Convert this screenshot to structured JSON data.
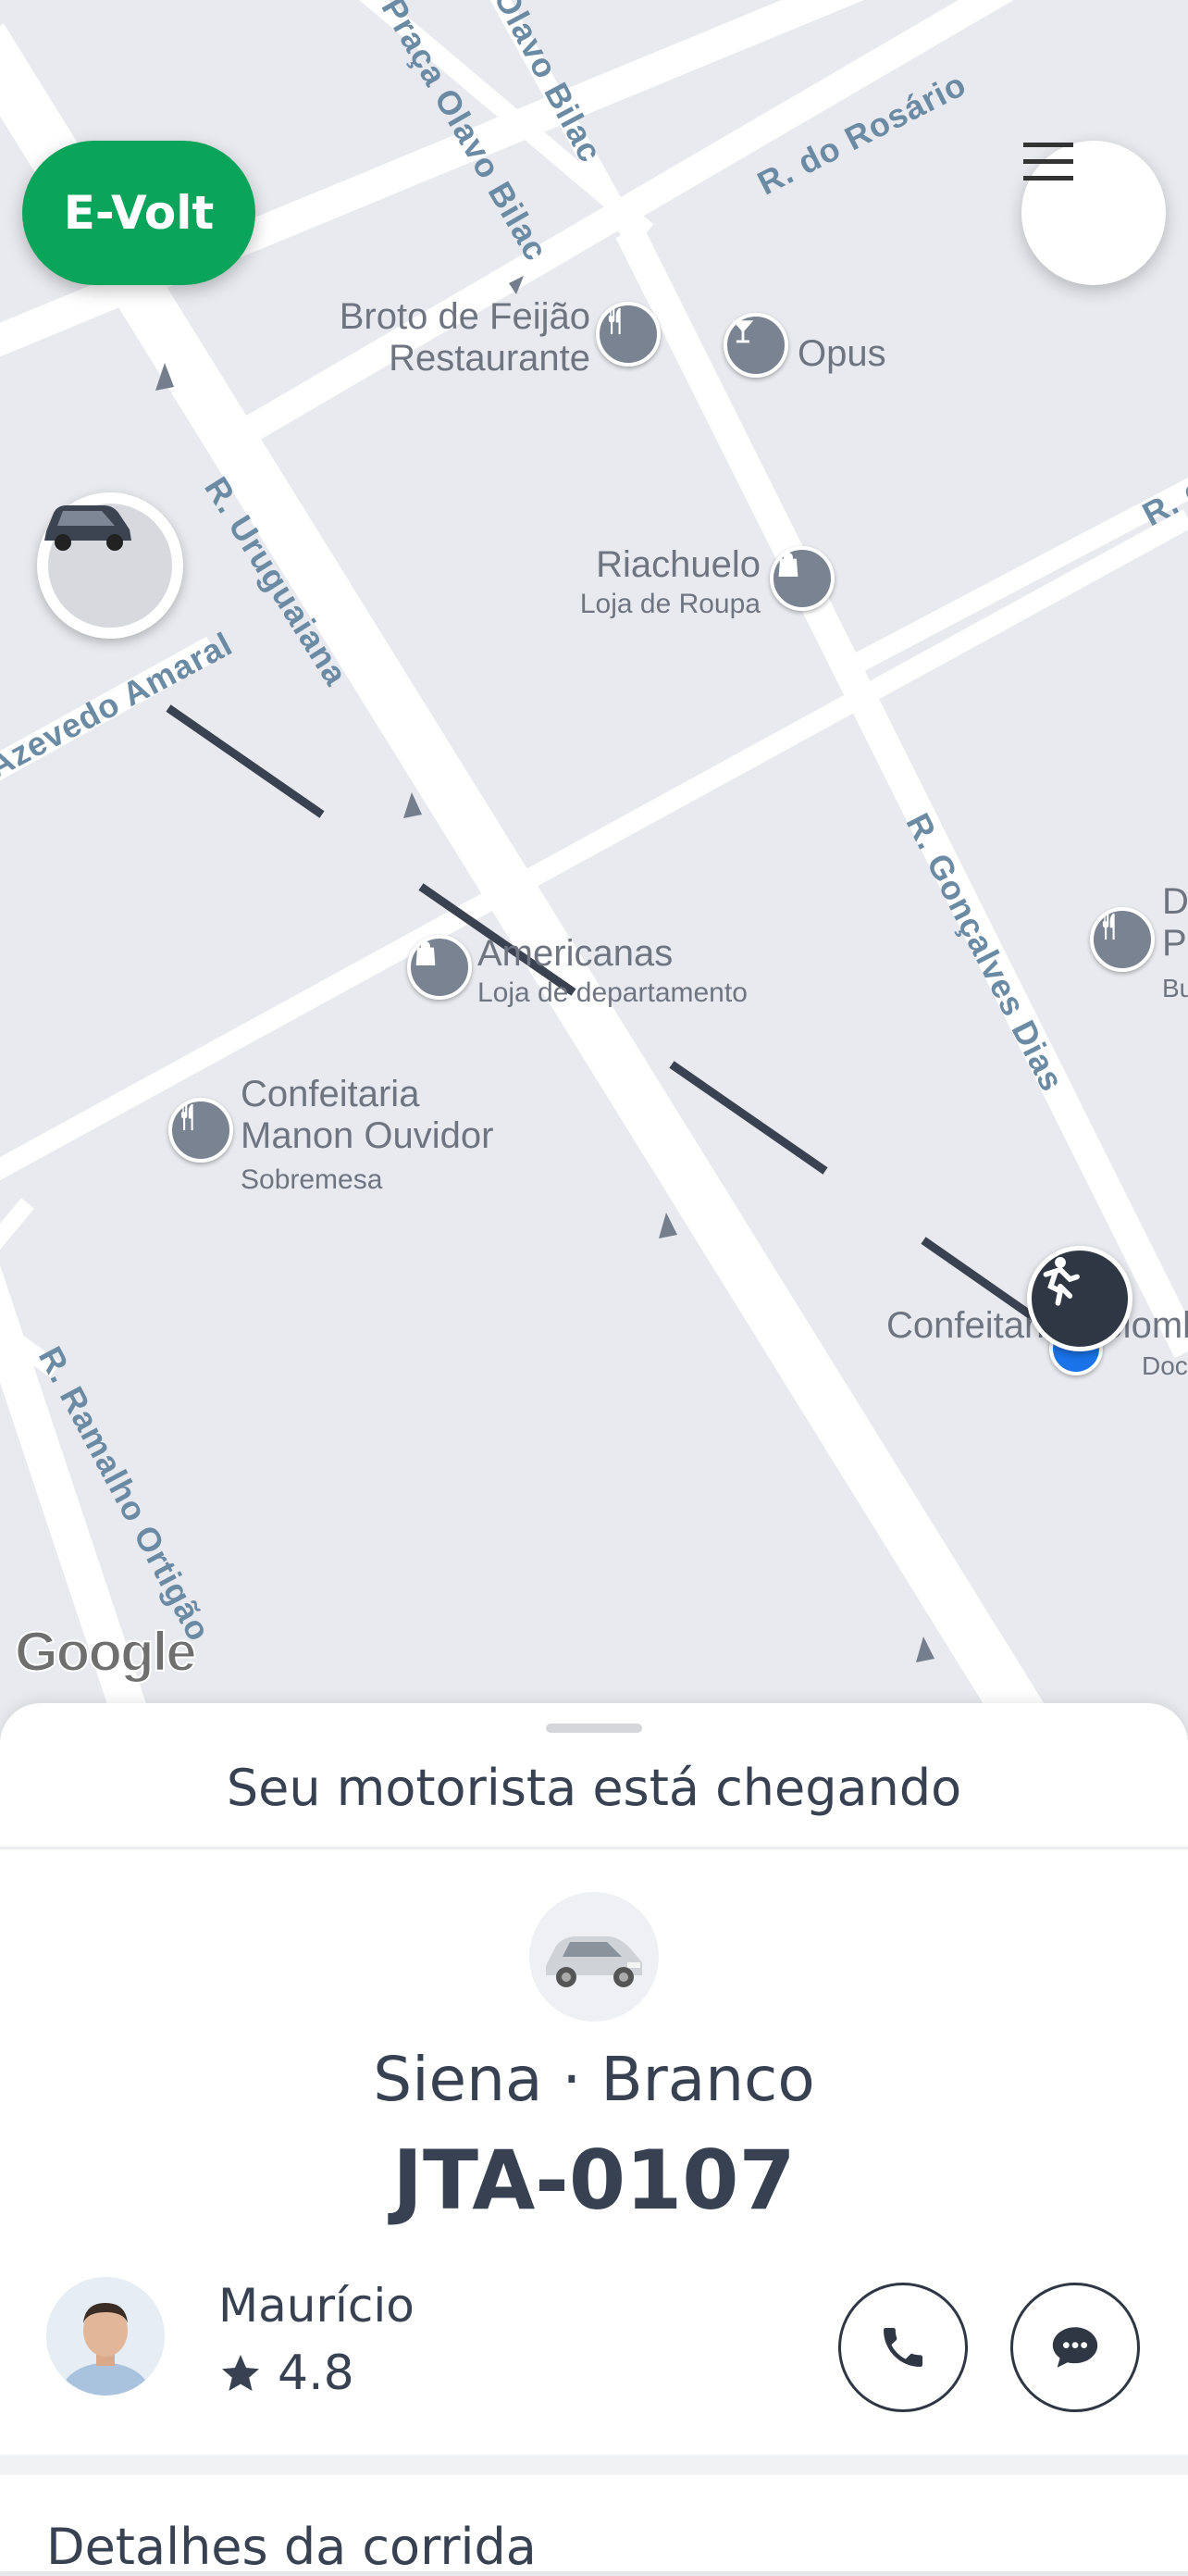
{
  "header": {
    "brand_label": "E-Volt",
    "menu_icon": "hamburger-menu-icon"
  },
  "map": {
    "provider": "Google",
    "streets": [
      "R. do Rosário",
      "Praça Olavo Bilac",
      "Olavo Bilac",
      "R. Uruguaiana",
      "Azevedo Amaral",
      "R. Gonçalves Dias",
      "R. Ramalho Ortigão",
      "R. d"
    ],
    "pois": [
      {
        "name": "Broto de Feijão\nRestaurante",
        "category": "",
        "icon": "restaurant-icon"
      },
      {
        "name": "Opus",
        "category": "",
        "icon": "bar-icon"
      },
      {
        "name": "Riachuelo",
        "category": "Loja de Roupa",
        "icon": "shopping-icon"
      },
      {
        "name": "Americanas",
        "category": "Loja de departamento",
        "icon": "shopping-icon"
      },
      {
        "name": "Confeitaria\nManon Ouvidor",
        "category": "Sobremesa",
        "icon": "restaurant-icon"
      },
      {
        "name": "D\nPr",
        "category": "Bu",
        "icon": "restaurant-icon"
      },
      {
        "name": "Confeitaria Colomb",
        "category": "Doc",
        "icon": "check-icon"
      }
    ],
    "markers": {
      "driver": "car-icon",
      "pickup": "passenger-icon"
    }
  },
  "sheet": {
    "status": "Seu motorista está chegando",
    "vehicle": {
      "model_color": "Siena · Branco",
      "plate": "JTA-0107"
    },
    "driver": {
      "name": "Maurício",
      "rating": "4.8"
    },
    "actions": {
      "call_icon": "phone-icon",
      "chat_icon": "chat-icon"
    },
    "section_title": "Detalhes da corrida"
  }
}
